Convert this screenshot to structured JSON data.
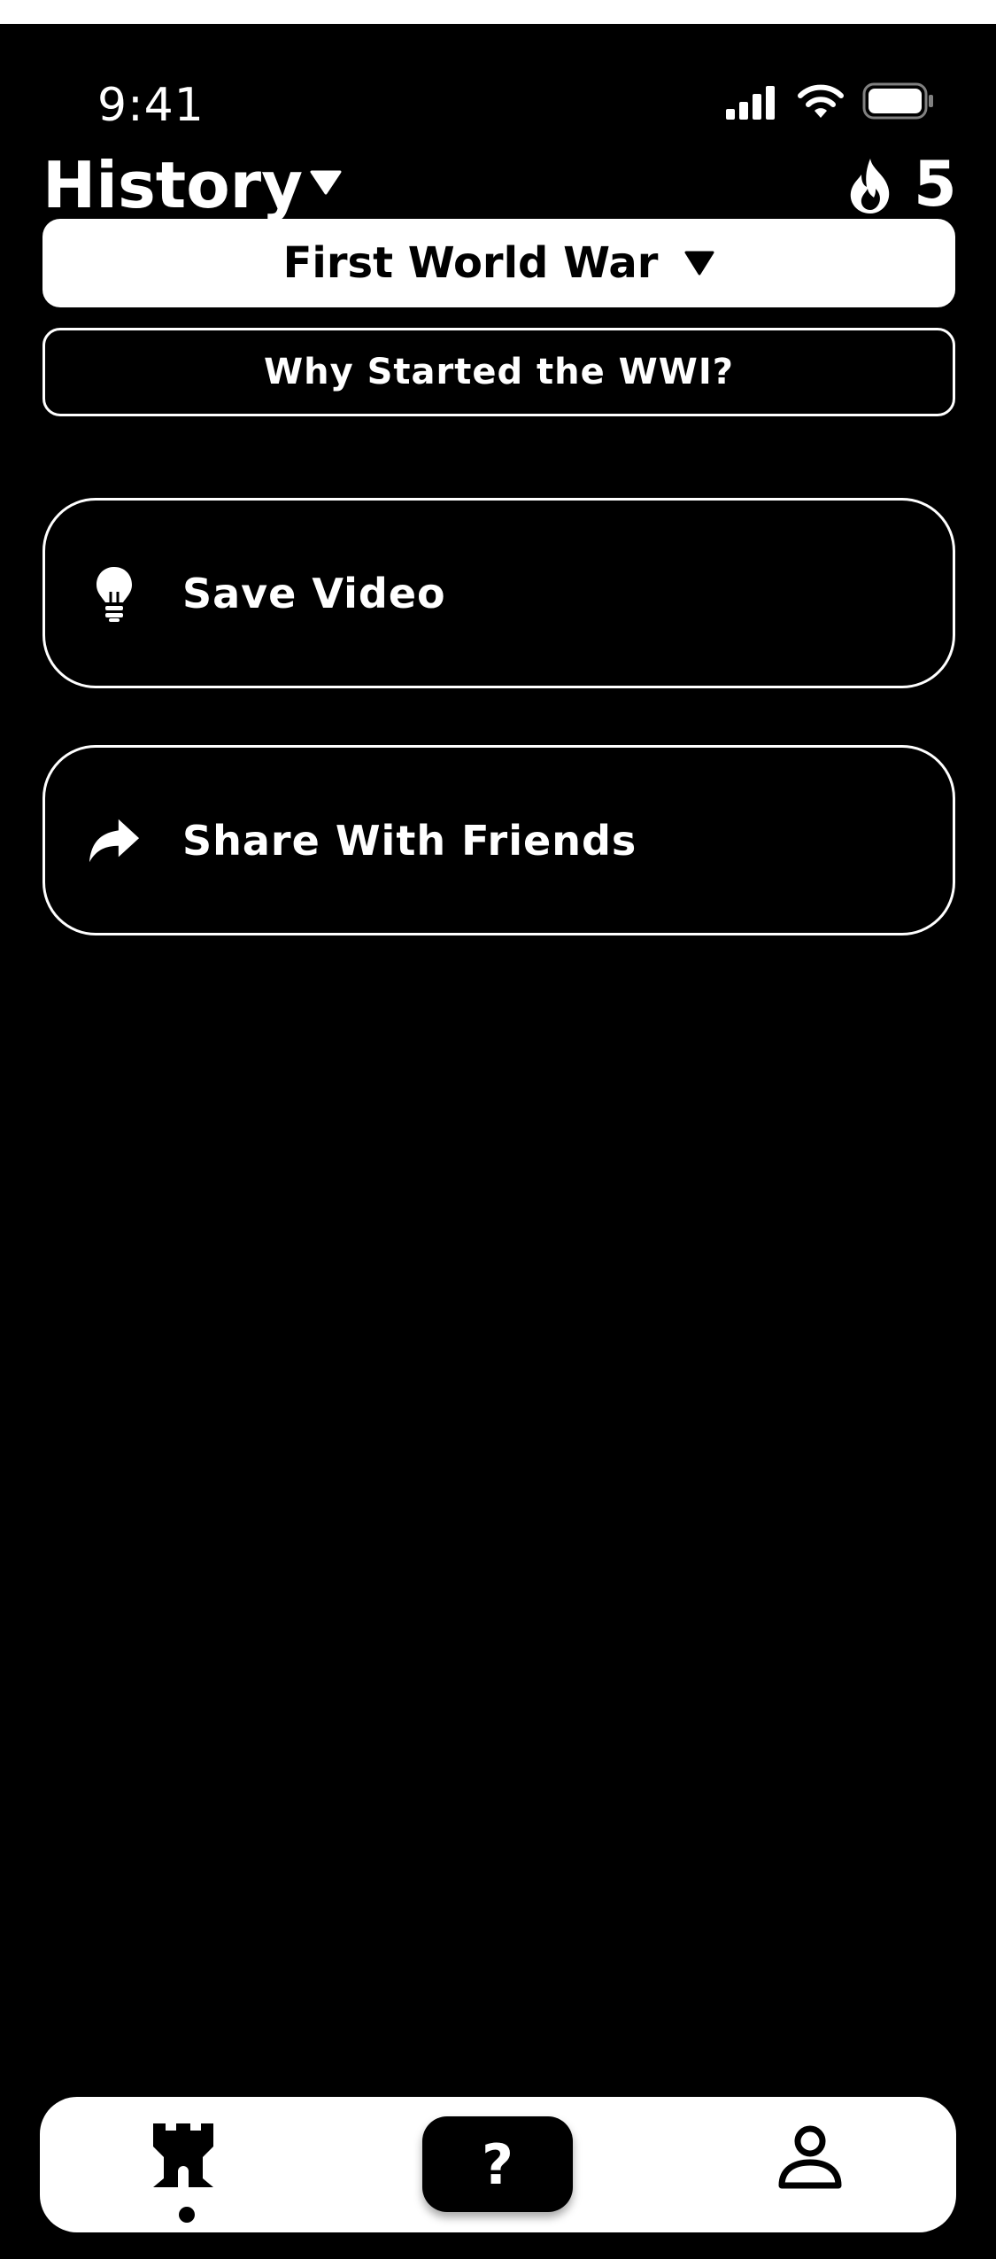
{
  "status_bar": {
    "time": "9:41",
    "icons": [
      "cellular-signal-icon",
      "wifi-icon",
      "battery-icon"
    ]
  },
  "header": {
    "title": "History",
    "title_dropdown_icon": "caret-down-icon",
    "streak_icon": "flame-icon",
    "streak_count": "5"
  },
  "topic": {
    "label": "First World War",
    "dropdown_icon": "caret-down-icon"
  },
  "subtopic": {
    "label": "Why Started the WWI?"
  },
  "actions": [
    {
      "label": "Save Video",
      "icon": "lightbulb-icon"
    },
    {
      "label": "Share With Friends",
      "icon": "share-arrow-icon"
    }
  ],
  "tab_bar": {
    "items": [
      {
        "name": "home",
        "icon": "castle-tower-icon",
        "active": true
      },
      {
        "name": "quiz",
        "icon": "question-mark-icon",
        "label": "?",
        "active": false
      },
      {
        "name": "profile",
        "icon": "user-icon",
        "active": false
      }
    ]
  },
  "colors": {
    "background": "#000000",
    "foreground": "#ffffff"
  }
}
